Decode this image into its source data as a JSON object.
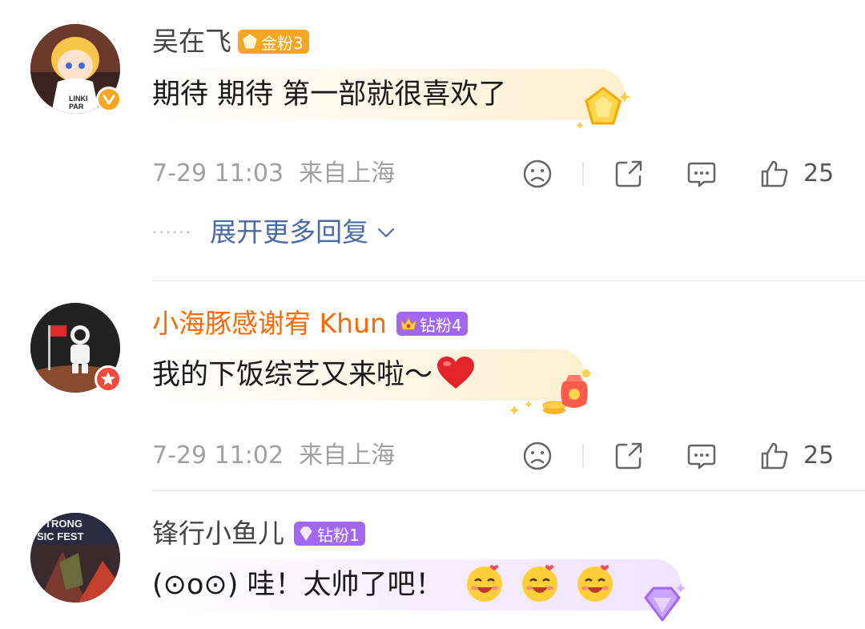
{
  "comments": [
    {
      "username": "吴在飞",
      "fan_badge": "金粉3",
      "text": "期待 期待 第一部就很喜欢了",
      "time": "7-29 11:03",
      "location": "来自上海",
      "likes": "25",
      "avatar_text": "LINKIN PARK",
      "expand_label": "展开更多回复",
      "expand_dots": "······"
    },
    {
      "username": "小海豚感谢宥 Khun",
      "fan_badge": "钻粉4",
      "text": "我的下饭综艺又来啦～",
      "time": "7-29 11:02",
      "location": "来自上海",
      "likes": "25"
    },
    {
      "username": "锋行小鱼儿",
      "fan_badge": "钻粉1",
      "text": "(⊙o⊙) 哇！太帅了吧！",
      "avatar_text": "STRONG MUSIC FEST"
    }
  ],
  "colors": {
    "gold_badge": "#f5a623",
    "purple_badge": "#a267f0",
    "vip_name": "#ff6a00",
    "link": "#4a6aa5",
    "meta": "#a0a0a0"
  },
  "icons": [
    "dislike-icon",
    "share-icon",
    "comment-icon",
    "like-icon",
    "chevron-down-icon",
    "verified-icon",
    "heart-emoji",
    "laugh-emoji"
  ]
}
